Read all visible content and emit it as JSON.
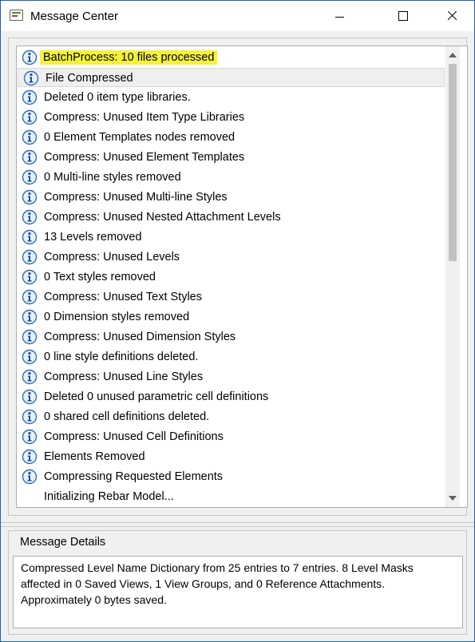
{
  "window": {
    "title": "Message Center"
  },
  "titlebar_icons": {
    "app": "message-center-app-icon",
    "minimize": "minimize-icon",
    "maximize": "maximize-icon",
    "close": "close-icon"
  },
  "messages": [
    {
      "text": "BatchProcess: 10 files processed",
      "icon": "info-icon",
      "highlighted": true
    },
    {
      "text": "File Compressed",
      "icon": "info-icon",
      "selected": true
    },
    {
      "text": "Deleted 0 item type libraries.",
      "icon": "info-icon"
    },
    {
      "text": "Compress: Unused Item Type Libraries",
      "icon": "info-icon"
    },
    {
      "text": "0 Element Templates nodes removed",
      "icon": "info-icon"
    },
    {
      "text": "Compress: Unused Element Templates",
      "icon": "info-icon"
    },
    {
      "text": "0 Multi-line styles removed",
      "icon": "info-icon"
    },
    {
      "text": "Compress: Unused Multi-line Styles",
      "icon": "info-icon"
    },
    {
      "text": "Compress: Unused Nested Attachment Levels",
      "icon": "info-icon"
    },
    {
      "text": "13 Levels removed",
      "icon": "info-icon"
    },
    {
      "text": "Compress: Unused Levels",
      "icon": "info-icon"
    },
    {
      "text": "0 Text styles removed",
      "icon": "info-icon"
    },
    {
      "text": "Compress: Unused Text Styles",
      "icon": "info-icon"
    },
    {
      "text": "0 Dimension styles removed",
      "icon": "info-icon"
    },
    {
      "text": "Compress: Unused Dimension Styles",
      "icon": "info-icon"
    },
    {
      "text": "0 line style definitions deleted.",
      "icon": "info-icon"
    },
    {
      "text": "Compress: Unused Line Styles",
      "icon": "info-icon"
    },
    {
      "text": "Deleted 0 unused parametric cell definitions",
      "icon": "info-icon"
    },
    {
      "text": "0 shared cell definitions deleted.",
      "icon": "info-icon"
    },
    {
      "text": "Compress: Unused Cell Definitions",
      "icon": "info-icon"
    },
    {
      "text": "Elements Removed",
      "icon": "info-icon"
    },
    {
      "text": "Compressing Requested Elements",
      "icon": "info-icon"
    },
    {
      "text": "Initializing Rebar Model...",
      "icon": null
    }
  ],
  "details": {
    "label": "Message Details",
    "text": "Compressed Level Name Dictionary from 25 entries to 7 entries. 8 Level Masks affected in 0 Saved Views, 1 View Groups, and 0 Reference Attachments. Approximately 0 bytes saved."
  },
  "colors": {
    "highlight": "#f5f23a",
    "icon_blue": "#2f6fb5",
    "window_border": "#1f5fa8"
  }
}
